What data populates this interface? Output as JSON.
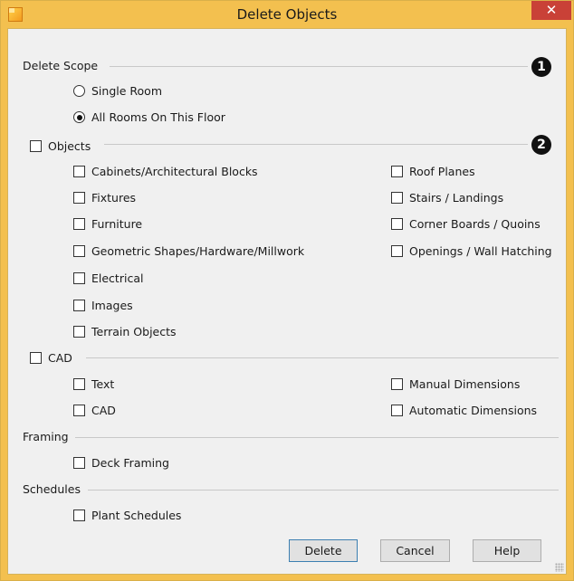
{
  "window": {
    "title": "Delete Objects",
    "close_glyph": "✕"
  },
  "scope": {
    "label": "Delete Scope",
    "callout": "1",
    "options": [
      {
        "label": "Single Room",
        "checked": false
      },
      {
        "label": "All Rooms On This Floor",
        "checked": true
      }
    ]
  },
  "objects": {
    "label": "Objects",
    "callout": "2",
    "checked": false,
    "left_items": [
      "Cabinets/Architectural Blocks",
      "Fixtures",
      "Furniture",
      "Geometric Shapes/Hardware/Millwork",
      "Electrical",
      "Images",
      "Terrain Objects"
    ],
    "right_items": [
      "Roof Planes",
      "Stairs / Landings",
      "Corner Boards / Quoins",
      "Openings / Wall Hatching"
    ]
  },
  "cad": {
    "label": "CAD",
    "checked": false,
    "left_items": [
      "Text",
      "CAD"
    ],
    "right_items": [
      "Manual Dimensions",
      "Automatic Dimensions"
    ]
  },
  "framing": {
    "label": "Framing",
    "items": [
      "Deck Framing"
    ]
  },
  "schedules": {
    "label": "Schedules",
    "items": [
      "Plant Schedules"
    ]
  },
  "buttons": {
    "delete": "Delete",
    "cancel": "Cancel",
    "help": "Help"
  }
}
